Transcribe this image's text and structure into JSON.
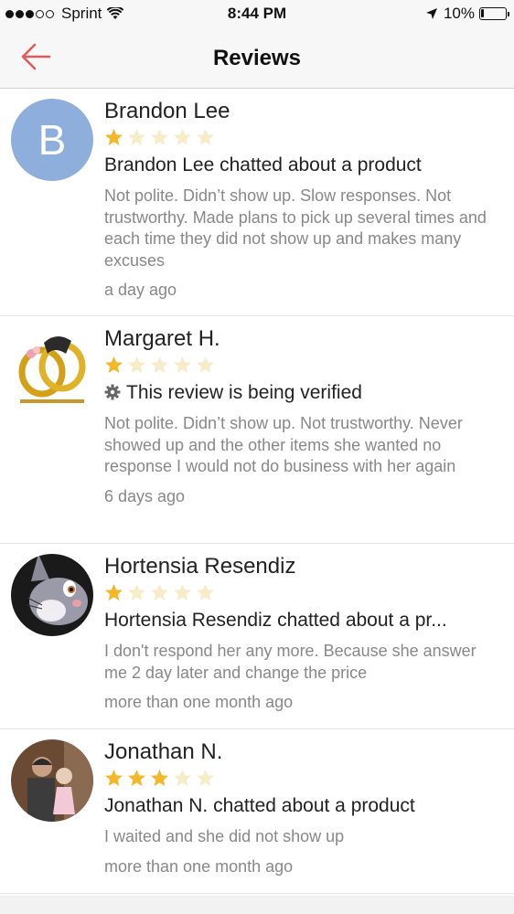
{
  "status_bar": {
    "carrier": "Sprint",
    "time": "8:44 PM",
    "battery": "10%",
    "battery_level": 0.1,
    "signal_bars": 3
  },
  "nav": {
    "title": "Reviews",
    "back_icon": "back-arrow-icon",
    "accent_color": "#e05a5a"
  },
  "reviews": [
    {
      "name": "Brandon Lee",
      "avatar_letter": "B",
      "rating": 1,
      "headline": "Brandon Lee chatted about a product",
      "body": "Not polite. Didn’t show up. Slow responses. Not trustworthy. Made plans to pick up several times and each time they did not show up and makes many excuses",
      "time": "a day ago"
    },
    {
      "name": "Margaret H.",
      "avatar": "wedding-rings-image",
      "rating": 1,
      "headline": "This review is being verified",
      "body": "Not polite. Didn’t show up. Not trustworthy. Never showed up and  the other items she wanted no response I would not do business with her again",
      "time": "6 days ago"
    },
    {
      "name": "Hortensia Resendiz",
      "avatar": "cartoon-rabbit-image",
      "rating": 1,
      "headline": "Hortensia Resendiz chatted about a pr...",
      "body": "I don't respond her any more. Because she answer me 2 day later and change the price",
      "time": "more than one month ago"
    },
    {
      "name": "Jonathan N.",
      "avatar": "family-photo-image",
      "rating": 3,
      "headline": "Jonathan N. chatted about a product",
      "body": "I waited and she did not show up",
      "time": "more than one month ago"
    }
  ],
  "colors": {
    "star_filled": "#f2b829",
    "star_empty": "#f7ecc8"
  }
}
